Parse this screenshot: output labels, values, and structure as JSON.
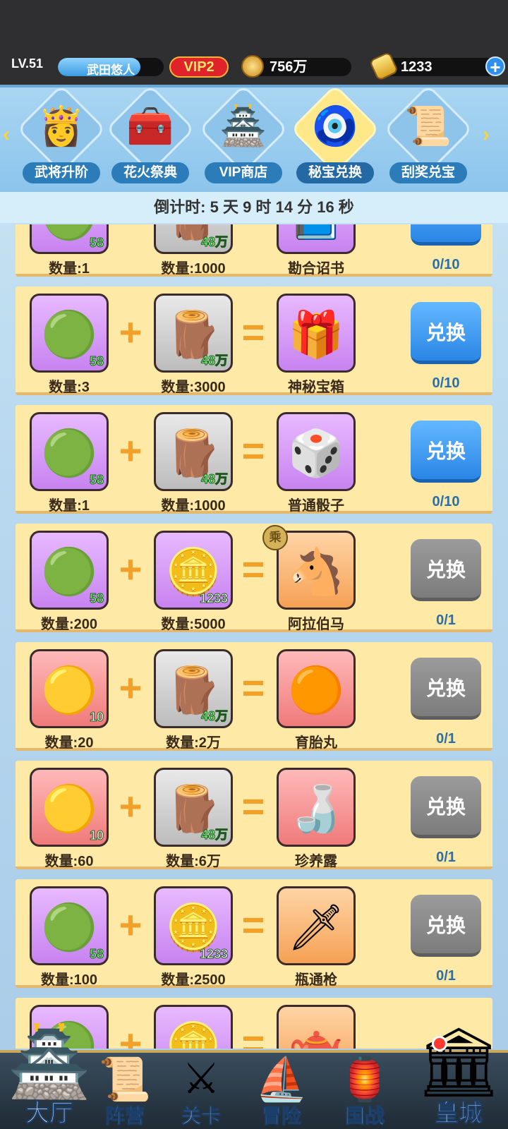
{
  "header": {
    "level": "LV.51",
    "player_name": "武田悠人",
    "name_bar_fill": 0.78,
    "vip": "VIP2",
    "coins": "756万",
    "gold": "1233"
  },
  "tabs": [
    {
      "label": "武将升阶",
      "icon": "warrior-girl-icon",
      "active": false
    },
    {
      "label": "花火祭典",
      "icon": "treasure-chest-icon",
      "active": false
    },
    {
      "label": "VIP商店",
      "icon": "vip-shop-icon",
      "active": false
    },
    {
      "label": "秘宝兑换",
      "icon": "jade-amulet-icon",
      "active": true
    },
    {
      "label": "刮奖兑宝",
      "icon": "scratch-card-icon",
      "active": false
    }
  ],
  "countdown": "倒计时: 5 天 9 时 14 分 16 秒",
  "button_label": "兑换",
  "rows": [
    {
      "a_qty": "数量:1",
      "a_count": "58",
      "b_qty": "数量:1000",
      "b_count": "48万",
      "result": "勘合诏书",
      "progress": "0/10",
      "enabled": true
    },
    {
      "a_qty": "数量:3",
      "a_count": "58",
      "b_qty": "数量:3000",
      "b_count": "48万",
      "result": "神秘宝箱",
      "progress": "0/10",
      "enabled": true
    },
    {
      "a_qty": "数量:1",
      "a_count": "58",
      "b_qty": "数量:1000",
      "b_count": "48万",
      "result": "普通骰子",
      "progress": "0/10",
      "enabled": true
    },
    {
      "a_qty": "数量:200",
      "a_count": "58",
      "b_qty": "数量:5000",
      "b_count": "1233",
      "result": "阿拉伯马",
      "progress": "0/1",
      "enabled": false,
      "badge": "乘"
    },
    {
      "a_qty": "数量:20",
      "a_count": "10",
      "b_qty": "数量:2万",
      "b_count": "48万",
      "result": "育胎丸",
      "progress": "0/1",
      "enabled": false
    },
    {
      "a_qty": "数量:60",
      "a_count": "10",
      "b_qty": "数量:6万",
      "b_count": "48万",
      "result": "珍养露",
      "progress": "0/1",
      "enabled": false
    },
    {
      "a_qty": "数量:100",
      "a_count": "58",
      "b_qty": "数量:2500",
      "b_count": "1233",
      "result": "瓶通枪",
      "progress": "0/1",
      "enabled": false
    }
  ],
  "nav": [
    {
      "label": "大厅",
      "icon": "castle-icon"
    },
    {
      "label": "阵营",
      "icon": "scroll-map-icon"
    },
    {
      "label": "关卡",
      "icon": "crossed-swords-icon"
    },
    {
      "label": "冒险",
      "icon": "ship-icon"
    },
    {
      "label": "国战",
      "icon": "war-banner-icon"
    },
    {
      "label": "皇城",
      "icon": "imperial-palace-icon"
    }
  ]
}
